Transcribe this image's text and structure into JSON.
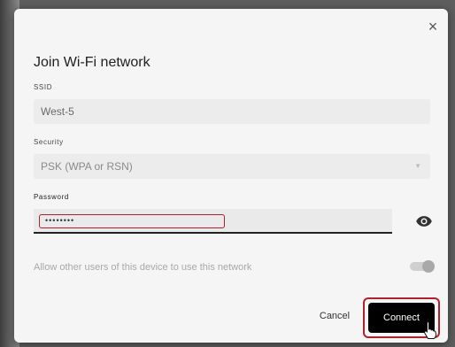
{
  "dialog": {
    "title": "Join Wi-Fi network",
    "close_glyph": "×",
    "ssid": {
      "label": "SSID",
      "value": "West-5"
    },
    "security": {
      "label": "Security",
      "value": "PSK (WPA or RSN)",
      "arrow_glyph": "▼"
    },
    "password": {
      "label": "Password",
      "value": "••••••••",
      "show_icon": "eye-icon"
    },
    "share_toggle": {
      "label": "Allow other users of this device to use this network",
      "state": "on"
    },
    "cancel_label": "Cancel",
    "connect_label": "Connect"
  },
  "colors": {
    "highlight": "#b0202d",
    "connect_bg": "#000000",
    "dialog_bg": "#f5f5f5"
  }
}
